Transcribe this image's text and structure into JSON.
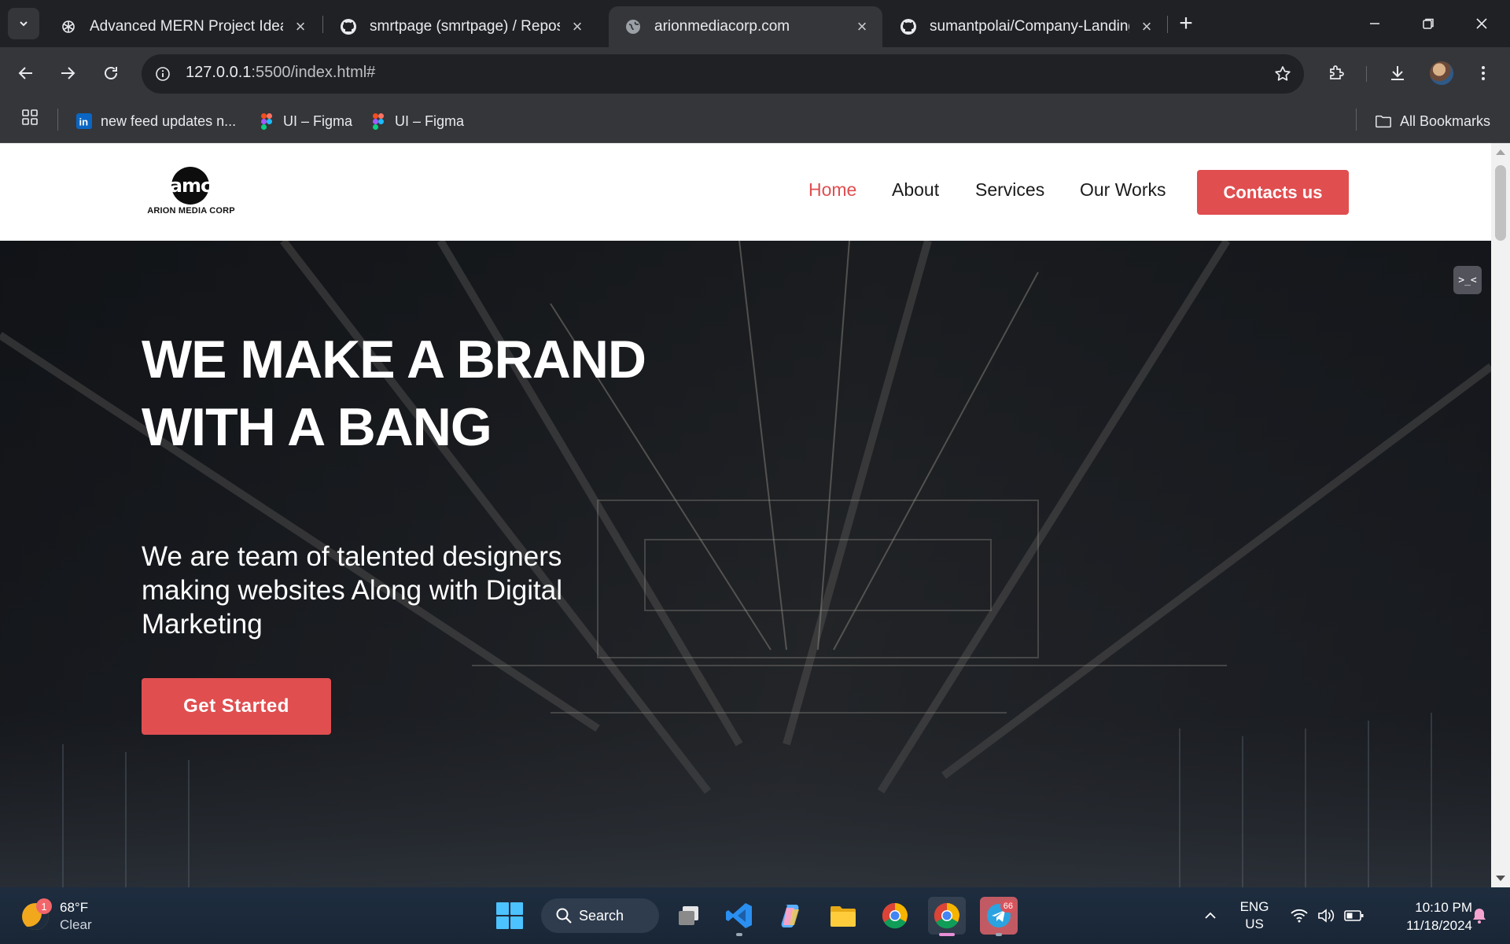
{
  "browser": {
    "tabs": [
      {
        "title": "Advanced MERN Project Ideas",
        "icon": "openai-icon"
      },
      {
        "title": "smrtpage (smrtpage) / Reposito",
        "icon": "github-icon"
      },
      {
        "title": "arionmediacorp.com",
        "icon": "globe-icon"
      },
      {
        "title": "sumantpolai/Company-Landing",
        "icon": "github-icon"
      }
    ],
    "url_host": "127.0.0.1",
    "url_path": ":5500/index.html#",
    "bookmarks": [
      {
        "label": "new feed updates n...",
        "icon": "linkedin-icon"
      },
      {
        "label": "UI – Figma",
        "icon": "figma-icon"
      },
      {
        "label": "UI – Figma",
        "icon": "figma-icon"
      }
    ],
    "all_bookmarks_label": "All Bookmarks"
  },
  "site": {
    "logo_mark": "amc",
    "logo_text": "ARION MEDIA CORP",
    "nav": {
      "home": "Home",
      "about": "About",
      "services": "Services",
      "works": "Our Works"
    },
    "cta": "Contacts us",
    "active_color": "#e04e50",
    "hero": {
      "title": "WE MAKE A BRAND WITH A BANG",
      "subtitle": "We are team of talented designers making websites Along with Digital Marketing",
      "button": "Get Started"
    },
    "ext_badge": ">_<"
  },
  "taskbar": {
    "weather_temp": "68°F",
    "weather_cond": "Clear",
    "weather_badge": "1",
    "search_label": "Search",
    "telegram_badge": "66",
    "lang_line1": "ENG",
    "lang_line2": "US",
    "time": "10:10 PM",
    "date": "11/18/2024"
  }
}
